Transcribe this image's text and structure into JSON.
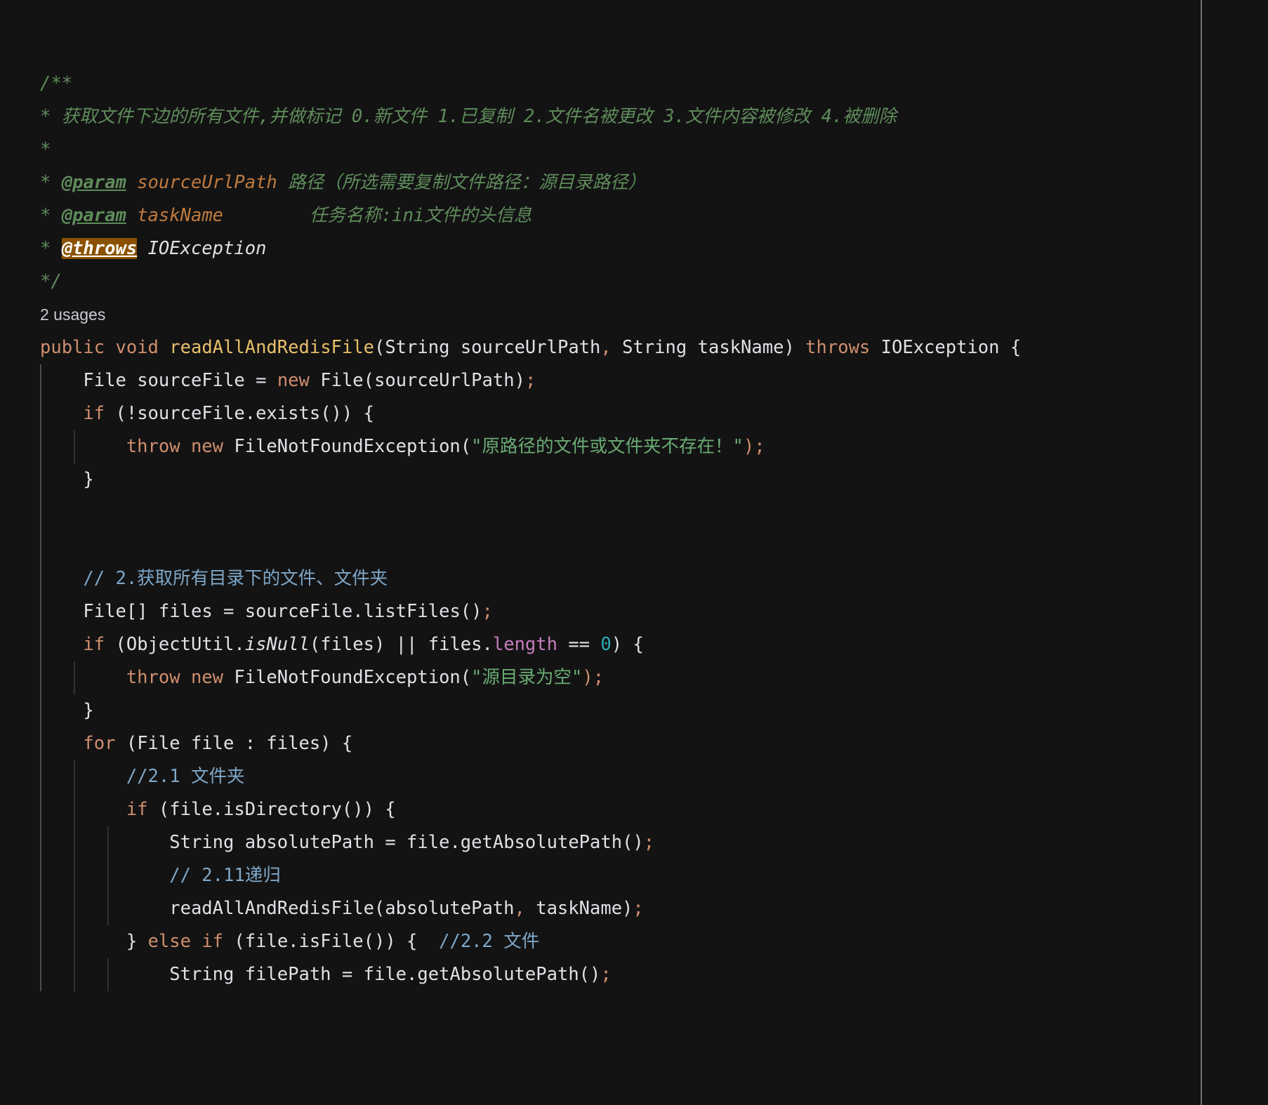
{
  "editor": {
    "theme": "dark",
    "background": "#131314",
    "language": "Java",
    "colors": {
      "doc_comment": "#5F8C5A",
      "doc_param_name": "#C07A3E",
      "keyword": "#CF8E6D",
      "method_name": "#E8BF6A",
      "plain_text": "#DFE1E5",
      "string": "#6AAB73",
      "number": "#2AACB8",
      "field": "#C77DBB",
      "line_comment": "#7EA7C7",
      "search_highlight_bg": "#8A5200",
      "right_rule": "#6E7074"
    },
    "code_vision": {
      "usages_label": "2 usages"
    },
    "javadoc": {
      "open": "/**",
      "description_marker": "*",
      "description": "获取文件下边的所有文件,并做标记 0.新文件 1.已复制 2.文件名被更改 3.文件内容被修改 4.被删除",
      "blank_marker": "*",
      "params": [
        {
          "marker": "*",
          "tag": "@param",
          "name": "sourceUrlPath",
          "description": "路径（所选需要复制文件路径：源目录路径）"
        },
        {
          "marker": "*",
          "tag": "@param",
          "name": "taskName",
          "spacer": "        ",
          "description": "任务名称:ini文件的头信息"
        }
      ],
      "throws": {
        "marker": "*",
        "tag": "@throws",
        "highlighted": true,
        "type": "IOException"
      },
      "close": "*/"
    },
    "signature": {
      "modifier": "public",
      "return_type": "void",
      "name": "readAllAndRedisFile",
      "params_open": "(",
      "param1_type": "String",
      "param1_name": "sourceUrlPath",
      "comma": ",",
      "param2_type": "String",
      "param2_name": "taskName",
      "params_close": ")",
      "throws_kw": "throws",
      "throws_type": "IOException",
      "brace": "{"
    },
    "statements": {
      "decl_sourcefile_type": "File",
      "decl_sourcefile_name": "sourceFile",
      "assign": "=",
      "kw_new": "new",
      "ctor_file": "File(sourceUrlPath)",
      "semi": ";",
      "kw_if": "if",
      "cond_exists": "(!sourceFile.exists()) {",
      "kw_throw": "throw",
      "exc_fnf": "FileNotFoundException(",
      "str_not_exists": "\"原路径的文件或文件夹不存在！\"",
      "close_paren_semi": ");",
      "brace_close": "}",
      "comment_get_all": "// 2.获取所有目录下的文件、文件夹",
      "files_type": "File[]",
      "files_name": "files",
      "files_init": "sourceFile.listFiles()",
      "cond_objectutil_open": "(ObjectUtil.",
      "isnull": "isNull",
      "isnull_args": "(files) || files.",
      "length": "length",
      "eqeq": " == ",
      "zero": "0",
      "cond_tail": ") {",
      "str_empty_dir": "\"源目录为空\"",
      "kw_for": "for",
      "for_header": "(File file : files) {",
      "comment_21": "//2.1 文件夹",
      "cond_isdirectory": "(file.isDirectory()) {",
      "abspath_type": "String",
      "abspath_name": "absolutePath",
      "abspath_init": "file.getAbsolutePath()",
      "comment_211": "// 2.11递归",
      "recurse_call": "readAllAndRedisFile(absolutePath",
      "recurse_comma": ",",
      "recurse_arg2": " taskName)",
      "brace_else": "}",
      "kw_else": "else",
      "kw_if2": "if",
      "cond_isfile": "(file.isFile()) {",
      "comment_22": "//2.2 文件",
      "filepath_type": "String",
      "filepath_name": "filePath",
      "filepath_init": "file.getAbsolutePath()"
    }
  }
}
